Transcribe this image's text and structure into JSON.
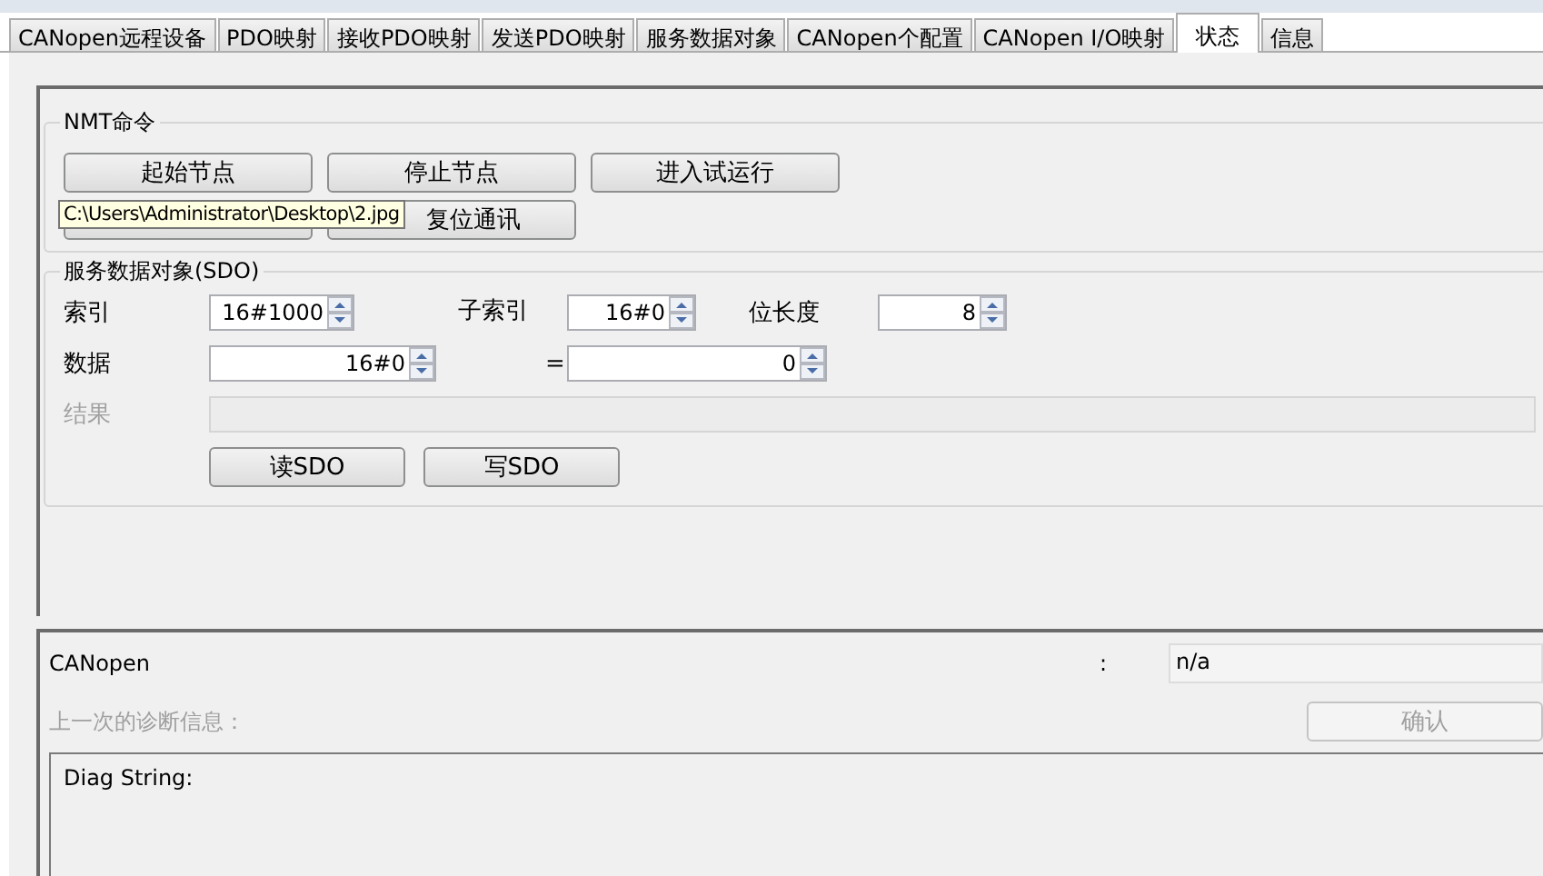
{
  "tabs": [
    {
      "label": "CANopen远程设备",
      "selected": false
    },
    {
      "label": "PDO映射",
      "selected": false
    },
    {
      "label": "接收PDO映射",
      "selected": false
    },
    {
      "label": "发送PDO映射",
      "selected": false
    },
    {
      "label": "服务数据对象",
      "selected": false
    },
    {
      "label": "CANopen个配置",
      "selected": false
    },
    {
      "label": "CANopen I/O映射",
      "selected": false
    },
    {
      "label": "状态",
      "selected": true
    },
    {
      "label": "信息",
      "selected": false
    }
  ],
  "nmt": {
    "title": "NMT命令",
    "buttons": [
      {
        "kind": "button",
        "label": "起始节点"
      },
      {
        "kind": "button",
        "label": "停止节点"
      },
      {
        "kind": "button",
        "label": "进入试运行"
      },
      {
        "kind": "covered"
      },
      {
        "kind": "button",
        "label": "复位通讯"
      }
    ]
  },
  "tooltip": {
    "text": "C:\\Users\\Administrator\\Desktop\\2.jpg"
  },
  "sdo": {
    "title": "服务数据对象(SDO)",
    "index": {
      "label": "索引",
      "value": "16#1000"
    },
    "subindex": {
      "label": "子索引",
      "value": "16#0"
    },
    "bit_length": {
      "label": "位长度",
      "value": "8"
    },
    "data": {
      "label": "数据",
      "value": "16#0"
    },
    "equals": {
      "label": "=",
      "value": "0"
    },
    "result": {
      "label": "结果"
    },
    "buttons": [
      "读SDO",
      "写SDO"
    ]
  },
  "status": {
    "label": "CANopen",
    "colon": ":",
    "value": "n/a"
  },
  "diagnosis": {
    "label": "上一次的诊断信息：",
    "disabled": true
  },
  "confirm": {
    "label": "确认",
    "disabled": true
  },
  "diag_text": "Diag String:"
}
